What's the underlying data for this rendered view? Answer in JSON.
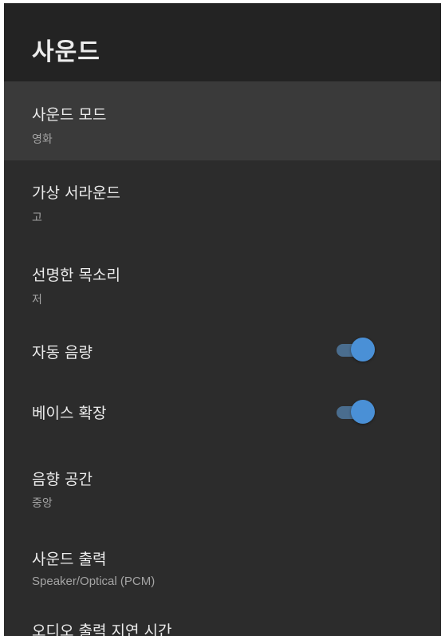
{
  "header": {
    "title": "사운드"
  },
  "items": [
    {
      "title": "사운드 모드",
      "value": "영화"
    },
    {
      "title": "가상 서라운드",
      "value": "고"
    },
    {
      "title": "선명한 목소리",
      "value": "저"
    },
    {
      "title": "자동 음량",
      "toggle": "on"
    },
    {
      "title": "베이스 확장",
      "toggle": "on"
    },
    {
      "title": "음향 공간",
      "value": "중앙"
    },
    {
      "title": "사운드 출력",
      "value": "Speaker/Optical (PCM)"
    },
    {
      "title": "오디오 출력 지연 시간"
    }
  ],
  "colors": {
    "background": "#2c2c2c",
    "header": "#232323",
    "selected": "#3a3a3a",
    "toggle_thumb": "#4a90d6",
    "toggle_track": "#4a6d8e"
  }
}
